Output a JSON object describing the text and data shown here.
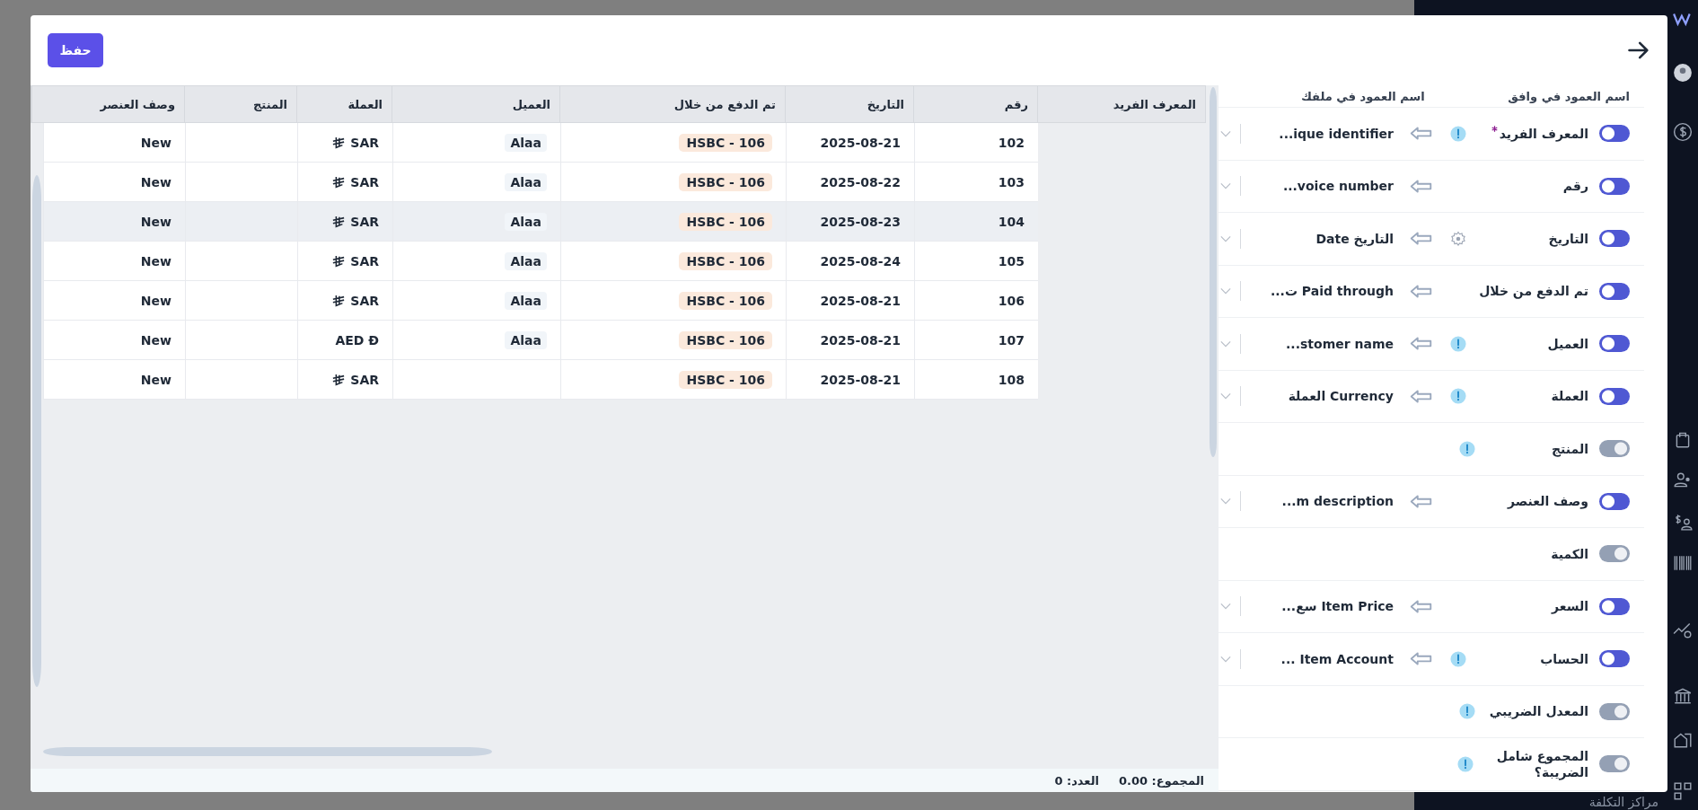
{
  "sidebar": {
    "bottom_label": "مراكز التكلفة"
  },
  "modal": {
    "save_button": "حفظ"
  },
  "mapping": {
    "headers": [
      "اسم العمود في وافق",
      "اسم العمود في ملفك"
    ],
    "items": [
      {
        "label": "المعرف الفريد",
        "required": true,
        "on": true,
        "info": true,
        "settings": false,
        "file_column": "ique identifier..."
      },
      {
        "label": "رقم",
        "required": false,
        "on": true,
        "info": false,
        "settings": false,
        "file_column": "voice number..."
      },
      {
        "label": "التاريخ",
        "required": false,
        "on": true,
        "info": false,
        "settings": true,
        "file_column": "التاريخ Date"
      },
      {
        "label": "تم الدفع من خلال",
        "required": false,
        "on": true,
        "info": false,
        "settings": false,
        "file_column": "Paid through ت..."
      },
      {
        "label": "العميل",
        "required": false,
        "on": true,
        "info": true,
        "settings": false,
        "file_column": "stomer name..."
      },
      {
        "label": "العملة",
        "required": false,
        "on": true,
        "info": true,
        "settings": false,
        "file_column": "Currency العملة"
      },
      {
        "label": "المنتج",
        "required": false,
        "on": false,
        "info": true,
        "settings": false
      },
      {
        "label": "وصف العنصر",
        "required": false,
        "on": true,
        "info": false,
        "settings": false,
        "file_column": "m description..."
      },
      {
        "label": "الكمية",
        "required": false,
        "on": false,
        "info": false,
        "settings": false
      },
      {
        "label": "السعر",
        "required": false,
        "on": true,
        "info": false,
        "settings": false,
        "file_column": "Item Price سع..."
      },
      {
        "label": "الحساب",
        "required": false,
        "on": true,
        "info": true,
        "settings": false,
        "file_column": "Item Account ..."
      },
      {
        "label": "المعدل الضريبي",
        "required": false,
        "on": false,
        "info": true,
        "settings": false
      },
      {
        "label": "المجموع شامل الضريبة؟",
        "required": false,
        "on": false,
        "info": true,
        "settings": false
      }
    ]
  },
  "table": {
    "columns": [
      "المعرف الفريد",
      "رقم",
      "التاريخ",
      "تم الدفع من خلال",
      "العميل",
      "العملة",
      "المنتج",
      "وصف العنصر"
    ],
    "rows": [
      {
        "number": "102",
        "date": "2025-08-21",
        "paid_through": "HSBC - 106",
        "customer": "Alaa",
        "currency": "SAR",
        "riyal_sign": true,
        "description": "New",
        "selected": false
      },
      {
        "number": "103",
        "date": "2025-08-22",
        "paid_through": "HSBC - 106",
        "customer": "Alaa",
        "currency": "SAR",
        "riyal_sign": true,
        "description": "New",
        "selected": false
      },
      {
        "number": "104",
        "date": "2025-08-23",
        "paid_through": "HSBC - 106",
        "customer": "Alaa",
        "currency": "SAR",
        "riyal_sign": true,
        "description": "New",
        "selected": true
      },
      {
        "number": "105",
        "date": "2025-08-24",
        "paid_through": "HSBC - 106",
        "customer": "Alaa",
        "currency": "SAR",
        "riyal_sign": true,
        "description": "New",
        "selected": false
      },
      {
        "number": "106",
        "date": "2025-08-21",
        "paid_through": "HSBC - 106",
        "customer": "Alaa",
        "currency": "SAR",
        "riyal_sign": true,
        "description": "New",
        "selected": false
      },
      {
        "number": "107",
        "date": "2025-08-21",
        "paid_through": "HSBC - 106",
        "customer": "Alaa",
        "currency": "AED Đ",
        "riyal_sign": false,
        "description": "New",
        "selected": false
      },
      {
        "number": "108",
        "date": "2025-08-21",
        "paid_through": "HSBC - 106",
        "currency": "SAR",
        "riyal_sign": true,
        "description": "New",
        "selected": false
      }
    ]
  },
  "footer": {
    "total": "المجموع: 0.00",
    "count": "العدد: 0"
  }
}
